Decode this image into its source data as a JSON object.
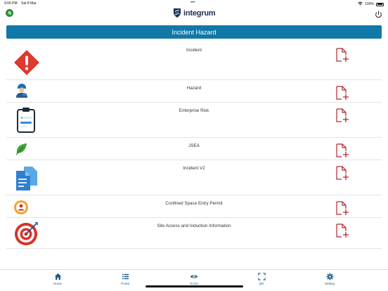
{
  "status": {
    "time": "9:06 PM",
    "date": "Sat 8 Mar",
    "battery": "100%",
    "dots": "•••"
  },
  "header": {
    "logo_text": "integrum"
  },
  "banner": {
    "title": "Incident Hazard"
  },
  "forms": [
    {
      "label": "Incident",
      "icon": "warning-diamond-icon"
    },
    {
      "label": "Hazard",
      "icon": "worker-icon"
    },
    {
      "label": "Enterprise Risk",
      "icon": "clipboard-icon"
    },
    {
      "label": "JSEA",
      "icon": "leaf-icon"
    },
    {
      "label": "Incident V2",
      "icon": "documents-icon"
    },
    {
      "label": "Confined Space Entry Permit",
      "icon": "person-badge-icon"
    },
    {
      "label": "Site Access and Induction Information",
      "icon": "target-icon"
    }
  ],
  "tabs": [
    {
      "label": "Home",
      "icon": "home-icon"
    },
    {
      "label": "Portal",
      "icon": "list-icon"
    },
    {
      "label": "To-Do",
      "icon": "eye-icon"
    },
    {
      "label": "QR",
      "icon": "qr-scan-icon"
    },
    {
      "label": "Setting",
      "icon": "gear-icon"
    }
  ],
  "colors": {
    "accent": "#1278a8",
    "add_icon": "#b5262c",
    "tab": "#1d5f86"
  }
}
